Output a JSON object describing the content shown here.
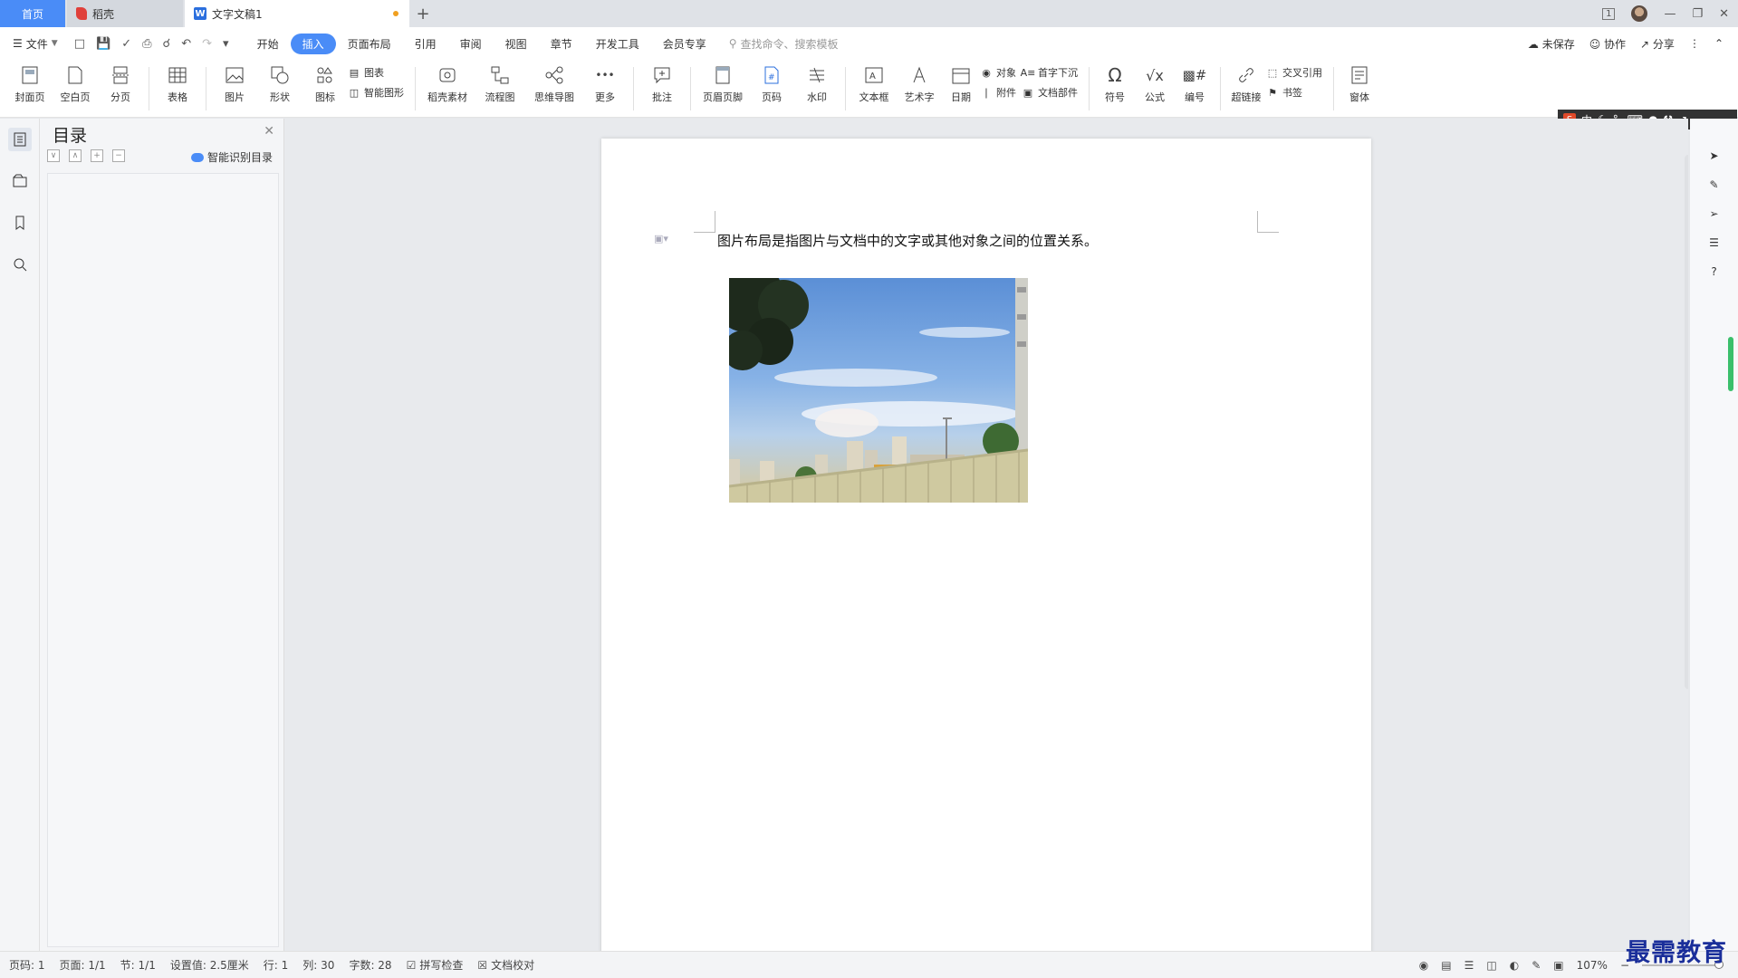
{
  "titlebar": {
    "tabs": [
      {
        "label": "首页"
      },
      {
        "label": "稻壳"
      },
      {
        "label": "文字文稿1"
      }
    ],
    "new_tab": "+",
    "page_badge": "1"
  },
  "menubar": {
    "file_label": "文件",
    "tabs": [
      "开始",
      "插入",
      "页面布局",
      "引用",
      "审阅",
      "视图",
      "章节",
      "开发工具",
      "会员专享"
    ],
    "active_tab": "插入",
    "search_placeholder": "查找命令、搜索模板",
    "right": {
      "unsaved": "未保存",
      "collab": "协作",
      "share": "分享"
    }
  },
  "ribbon": {
    "cover": "封面页",
    "blank": "空白页",
    "pagebreak": "分页",
    "table": "表格",
    "picture": "图片",
    "shape": "形状",
    "icons": "图标",
    "chart": "图表",
    "smartart": "智能图形",
    "docer": "稻壳素材",
    "flowchart": "流程图",
    "mindmap": "思维导图",
    "more": "更多",
    "comment": "批注",
    "header_footer": "页眉页脚",
    "page_number": "页码",
    "watermark": "水印",
    "textbox": "文本框",
    "wordart": "艺术字",
    "date": "日期",
    "object": "对象",
    "attachment": "附件",
    "dropcap": "首字下沉",
    "docpart": "文档部件",
    "symbol": "符号",
    "equation": "公式",
    "numbering": "编号",
    "hyperlink": "超链接",
    "crossref": "交叉引用",
    "bookmark": "书签",
    "form": "窗体"
  },
  "ime": {
    "mode": "中"
  },
  "toc": {
    "title": "目录",
    "smart_label": "智能识别目录"
  },
  "document": {
    "paragraph": "图片布局是指图片与文档中的文字或其他对象之间的位置关系。"
  },
  "statusbar": {
    "page": "页码: 1",
    "pages": "页面: 1/1",
    "section": "节: 1/1",
    "setting": "设置值: 2.5厘米",
    "row": "行: 1",
    "col": "列: 30",
    "words": "字数: 28",
    "spell": "拼写检查",
    "proof": "文档校对",
    "zoom": "107%"
  },
  "watermark_text": "最需教育",
  "colors": {
    "accent": "#4a8cf7",
    "status_green": "#3bbf6b"
  }
}
